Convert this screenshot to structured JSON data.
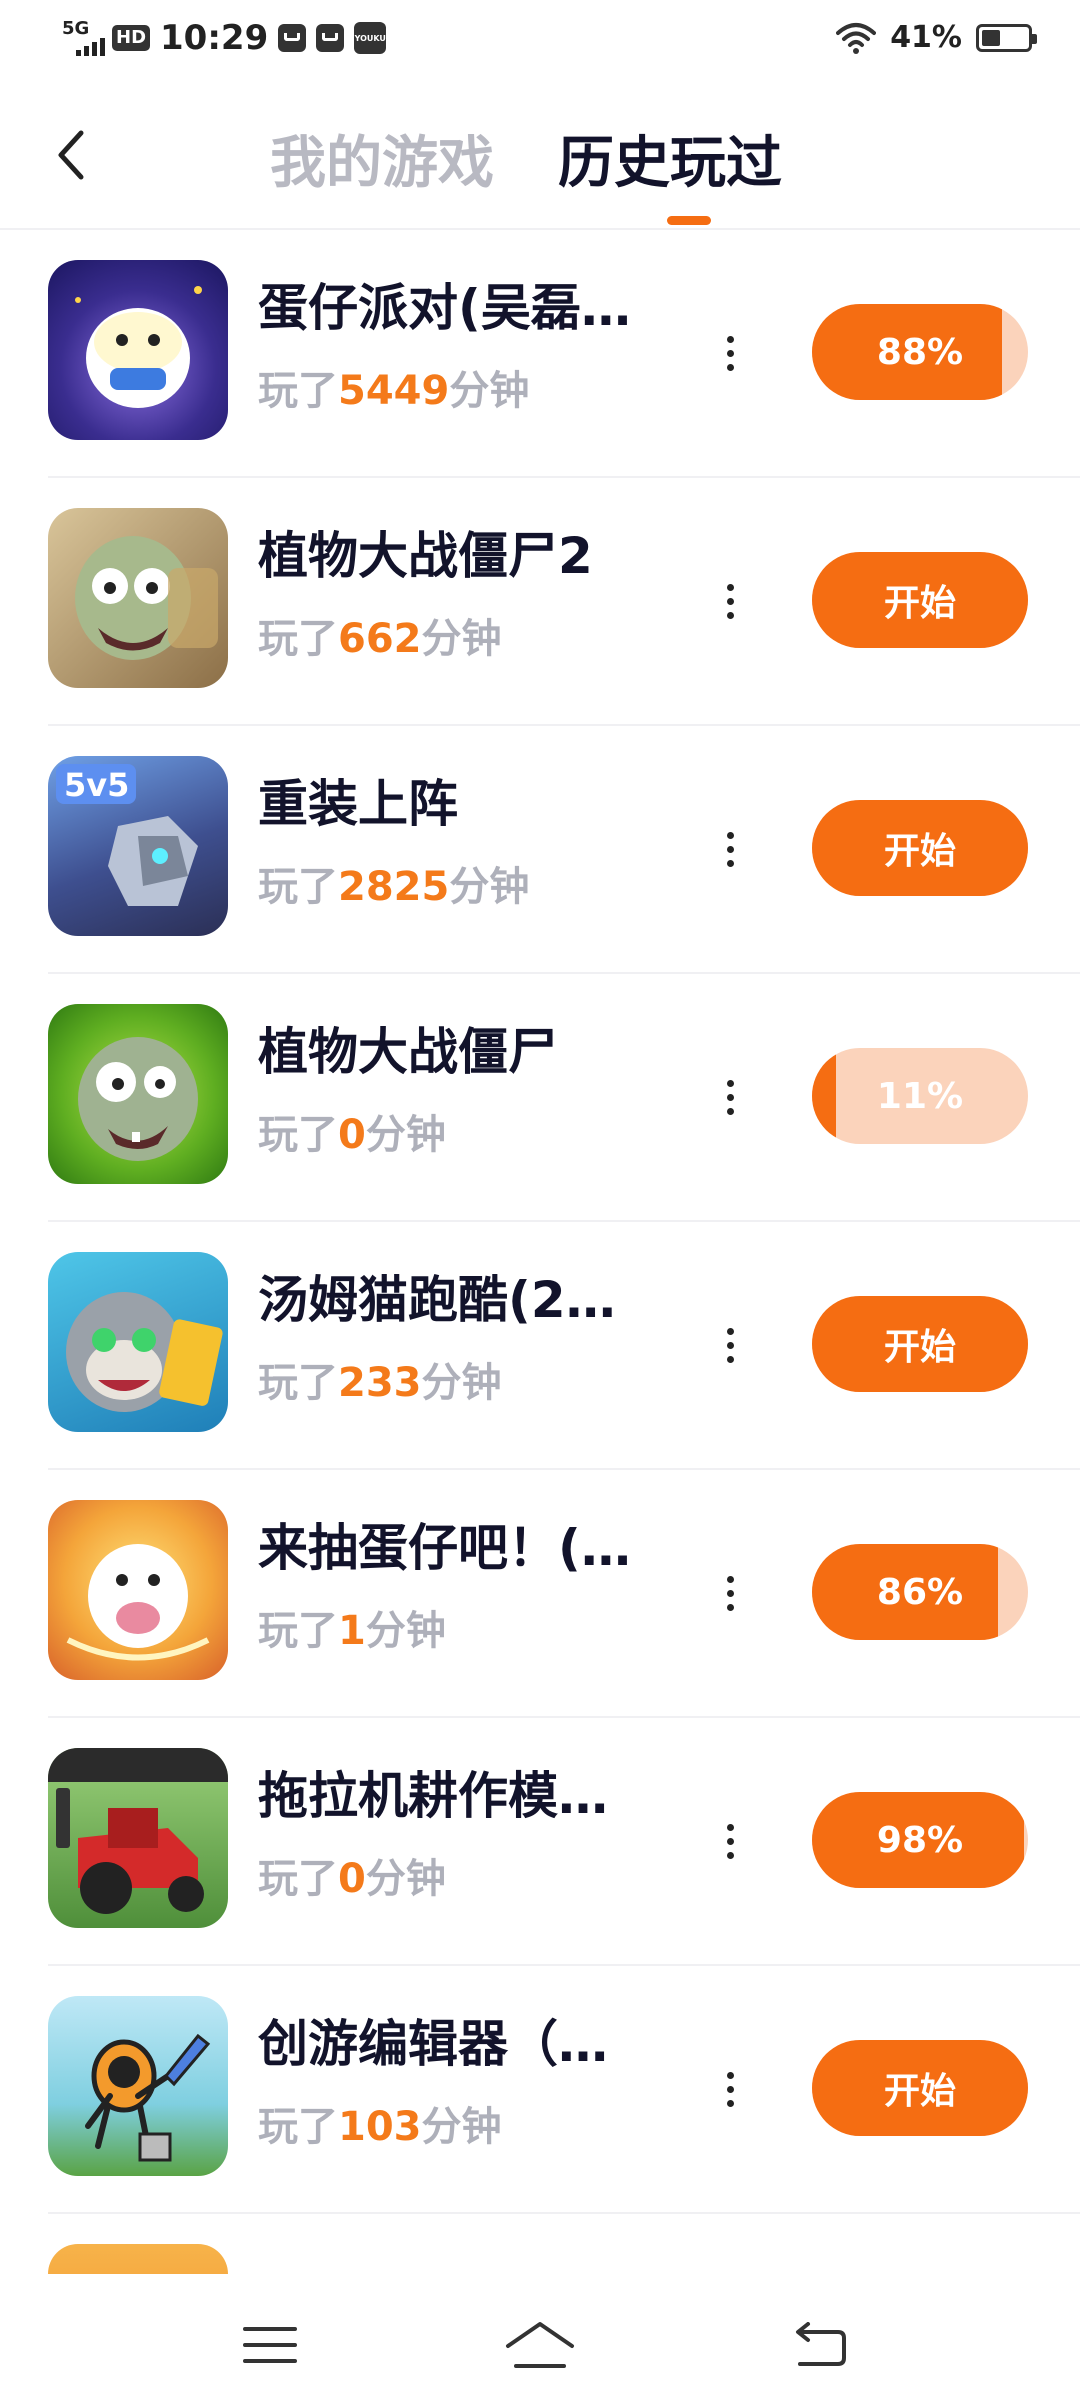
{
  "status_bar": {
    "network": "5G",
    "hd": "HD",
    "time": "10:29",
    "youku": "YOUKU",
    "battery_percent": "41%",
    "battery_level": 0.41
  },
  "header": {
    "tab_mine": "我的游戏",
    "tab_history": "历史玩过",
    "active_tab": "历史玩过"
  },
  "games": [
    {
      "title": "蛋仔派对(吴磊…",
      "played_prefix": "玩了",
      "minutes": "5449",
      "played_suffix": "分钟",
      "button": "88%",
      "progress": 0.88,
      "icon": "eggy-party-icon"
    },
    {
      "title": "植物大战僵尸2",
      "played_prefix": "玩了",
      "minutes": "662",
      "played_suffix": "分钟",
      "button": "开始",
      "progress": 1.0,
      "icon": "pvz2-icon"
    },
    {
      "title": "重装上阵",
      "played_prefix": "玩了",
      "minutes": "2825",
      "played_suffix": "分钟",
      "button": "开始",
      "progress": 1.0,
      "icon": "mech-5v5-icon"
    },
    {
      "title": "植物大战僵尸",
      "played_prefix": "玩了",
      "minutes": "0",
      "played_suffix": "分钟",
      "button": "11%",
      "progress": 0.11,
      "icon": "pvz-icon"
    },
    {
      "title": "汤姆猫跑酷(2…",
      "played_prefix": "玩了",
      "minutes": "233",
      "played_suffix": "分钟",
      "button": "开始",
      "progress": 1.0,
      "icon": "tom-cat-icon"
    },
    {
      "title": "来抽蛋仔吧！(…",
      "played_prefix": "玩了",
      "minutes": "1",
      "played_suffix": "分钟",
      "button": "86%",
      "progress": 0.86,
      "icon": "eggy-draw-icon"
    },
    {
      "title": "拖拉机耕作模…",
      "played_prefix": "玩了",
      "minutes": "0",
      "played_suffix": "分钟",
      "button": "98%",
      "progress": 0.98,
      "icon": "tractor-icon"
    },
    {
      "title": "创游编辑器（…",
      "played_prefix": "玩了",
      "minutes": "103",
      "played_suffix": "分钟",
      "button": "开始",
      "progress": 1.0,
      "icon": "editor-icon"
    }
  ],
  "colors": {
    "accent": "#f56d12",
    "progress_track": "#fbd3bb",
    "minutes_text": "#f47a1a",
    "muted_text": "#aeb0ba"
  },
  "nav_bar": {
    "menu_icon": "menu-icon",
    "home_icon": "home-icon",
    "back_icon": "back-icon"
  }
}
